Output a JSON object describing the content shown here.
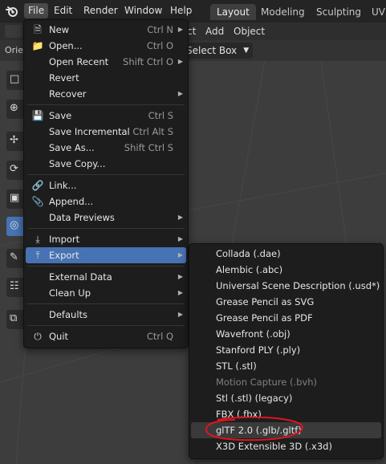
{
  "topbar": {
    "menus": [
      "File",
      "Edit",
      "Render",
      "Window",
      "Help"
    ],
    "workspaces": [
      "Layout",
      "Modeling",
      "Sculpting",
      "UV"
    ]
  },
  "header": {
    "items": [
      "ct",
      "Add",
      "Object"
    ],
    "orientation_label": "Orie",
    "select_mode": "Select Box"
  },
  "file_menu": {
    "items": [
      {
        "label": "New",
        "shortcut": "Ctrl N",
        "icon": "new-file-icon",
        "submenu": true
      },
      {
        "label": "Open...",
        "shortcut": "Ctrl O",
        "icon": "folder-icon",
        "submenu": false
      },
      {
        "label": "Open Recent",
        "shortcut": "Shift Ctrl O",
        "icon": "",
        "submenu": true
      },
      {
        "label": "Revert",
        "shortcut": "",
        "icon": "",
        "submenu": false
      },
      {
        "label": "Recover",
        "shortcut": "",
        "icon": "",
        "submenu": true
      },
      {
        "label": "Save",
        "shortcut": "Ctrl S",
        "icon": "save-icon",
        "submenu": false
      },
      {
        "label": "Save Incremental",
        "shortcut": "Ctrl Alt S",
        "icon": "",
        "submenu": false
      },
      {
        "label": "Save As...",
        "shortcut": "Shift Ctrl S",
        "icon": "",
        "submenu": false
      },
      {
        "label": "Save Copy...",
        "shortcut": "",
        "icon": "",
        "submenu": false
      },
      {
        "label": "Link...",
        "shortcut": "",
        "icon": "link-icon",
        "submenu": false
      },
      {
        "label": "Append...",
        "shortcut": "",
        "icon": "paperclip-icon",
        "submenu": false
      },
      {
        "label": "Data Previews",
        "shortcut": "",
        "icon": "",
        "submenu": true
      },
      {
        "label": "Import",
        "shortcut": "",
        "icon": "import-icon",
        "submenu": true
      },
      {
        "label": "Export",
        "shortcut": "",
        "icon": "export-icon",
        "submenu": true
      },
      {
        "label": "External Data",
        "shortcut": "",
        "icon": "",
        "submenu": true
      },
      {
        "label": "Clean Up",
        "shortcut": "",
        "icon": "",
        "submenu": true
      },
      {
        "label": "Defaults",
        "shortcut": "",
        "icon": "",
        "submenu": true
      },
      {
        "label": "Quit",
        "shortcut": "Ctrl Q",
        "icon": "power-icon",
        "submenu": false
      }
    ]
  },
  "export_menu": {
    "items": [
      "Collada (.dae)",
      "Alembic (.abc)",
      "Universal Scene Description (.usd*)",
      "Grease Pencil as SVG",
      "Grease Pencil as PDF",
      "Wavefront (.obj)",
      "Stanford PLY (.ply)",
      "STL (.stl)",
      "Motion Capture (.bvh)",
      "Stl (.stl) (legacy)",
      "FBX (.fbx)",
      "glTF 2.0 (.glb/.gltf)",
      "X3D Extensible 3D (.x3d)"
    ],
    "disabled_item": "Motion Capture (.bvh)",
    "highlighted_item": "glTF 2.0 (.glb/.gltf)",
    "annotation_color": "#e0141e"
  },
  "colors": {
    "accent": "#4772b3",
    "menu_bg": "#1d1d1d",
    "topbar_bg": "#242424"
  }
}
